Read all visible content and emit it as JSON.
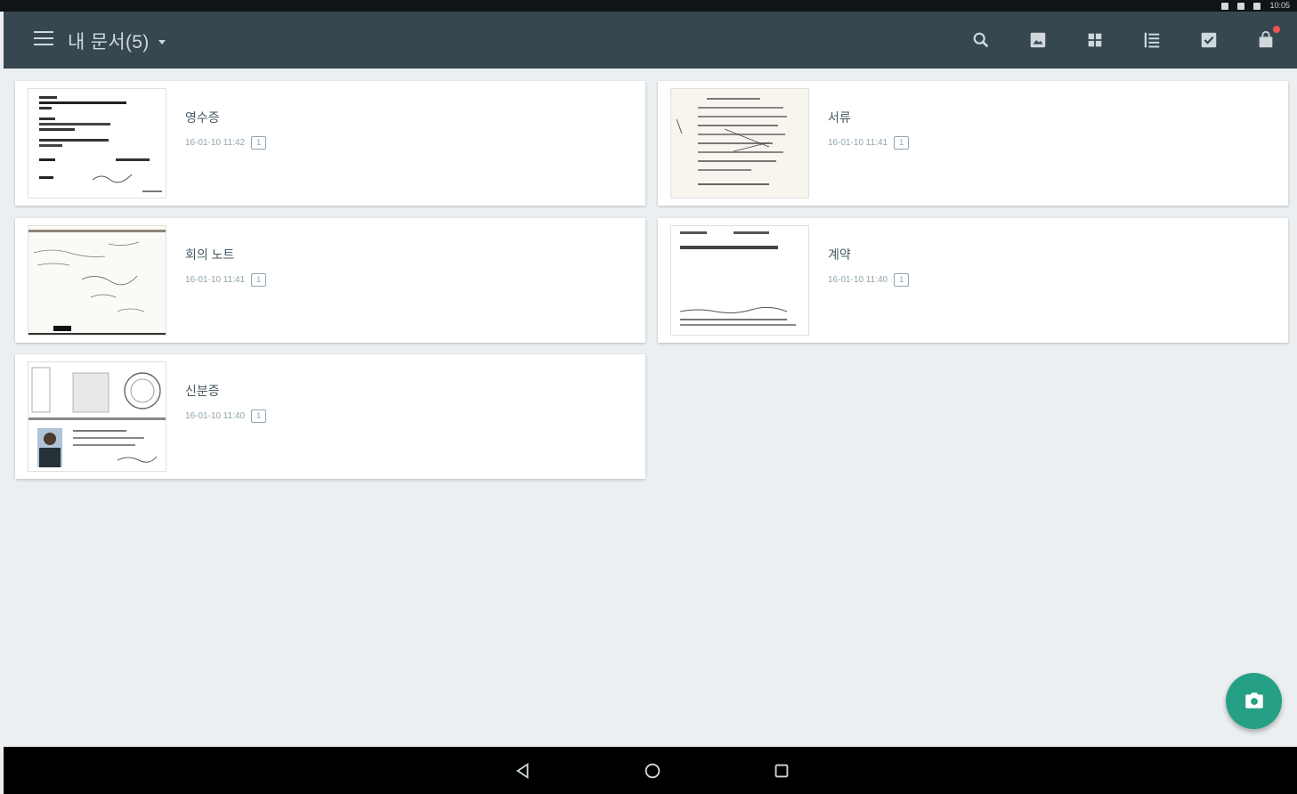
{
  "status_bar": {
    "time": "10:05"
  },
  "app_bar": {
    "title": "내 문서(5)",
    "actions": [
      "search-icon",
      "gallery-import-icon",
      "grid-view-icon",
      "list-view-icon",
      "select-check-icon",
      "store-bag-icon"
    ]
  },
  "documents": [
    {
      "name": "영수증",
      "date": "16-01-10 11:42",
      "pages": "1"
    },
    {
      "name": "서류",
      "date": "16-01-10 11:41",
      "pages": "1"
    },
    {
      "name": "회의 노트",
      "date": "16-01-10 11:41",
      "pages": "1"
    },
    {
      "name": "계약",
      "date": "16-01-10 11:40",
      "pages": "1"
    },
    {
      "name": "신분증",
      "date": "16-01-10 11:40",
      "pages": "1"
    }
  ],
  "fab": {
    "icon": "camera-icon"
  },
  "nav_bar": {
    "buttons": [
      "back-icon",
      "home-icon",
      "recents-icon"
    ]
  },
  "colors": {
    "app_bar": "#37474f",
    "background": "#eceff1",
    "fab": "#26a085"
  }
}
